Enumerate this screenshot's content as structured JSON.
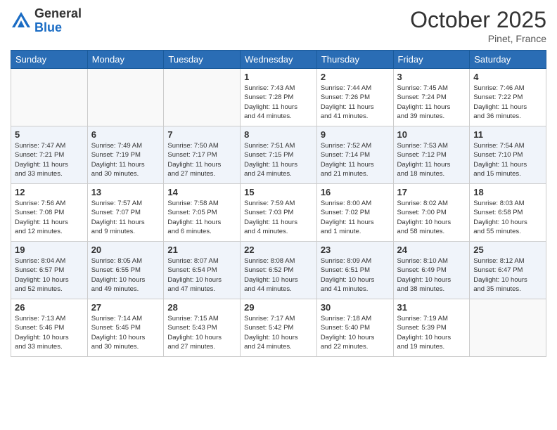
{
  "header": {
    "logo_general": "General",
    "logo_blue": "Blue",
    "month_title": "October 2025",
    "location": "Pinet, France"
  },
  "days_of_week": [
    "Sunday",
    "Monday",
    "Tuesday",
    "Wednesday",
    "Thursday",
    "Friday",
    "Saturday"
  ],
  "weeks": [
    {
      "alt": false,
      "days": [
        {
          "number": "",
          "info": ""
        },
        {
          "number": "",
          "info": ""
        },
        {
          "number": "",
          "info": ""
        },
        {
          "number": "1",
          "info": "Sunrise: 7:43 AM\nSunset: 7:28 PM\nDaylight: 11 hours\nand 44 minutes."
        },
        {
          "number": "2",
          "info": "Sunrise: 7:44 AM\nSunset: 7:26 PM\nDaylight: 11 hours\nand 41 minutes."
        },
        {
          "number": "3",
          "info": "Sunrise: 7:45 AM\nSunset: 7:24 PM\nDaylight: 11 hours\nand 39 minutes."
        },
        {
          "number": "4",
          "info": "Sunrise: 7:46 AM\nSunset: 7:22 PM\nDaylight: 11 hours\nand 36 minutes."
        }
      ]
    },
    {
      "alt": true,
      "days": [
        {
          "number": "5",
          "info": "Sunrise: 7:47 AM\nSunset: 7:21 PM\nDaylight: 11 hours\nand 33 minutes."
        },
        {
          "number": "6",
          "info": "Sunrise: 7:49 AM\nSunset: 7:19 PM\nDaylight: 11 hours\nand 30 minutes."
        },
        {
          "number": "7",
          "info": "Sunrise: 7:50 AM\nSunset: 7:17 PM\nDaylight: 11 hours\nand 27 minutes."
        },
        {
          "number": "8",
          "info": "Sunrise: 7:51 AM\nSunset: 7:15 PM\nDaylight: 11 hours\nand 24 minutes."
        },
        {
          "number": "9",
          "info": "Sunrise: 7:52 AM\nSunset: 7:14 PM\nDaylight: 11 hours\nand 21 minutes."
        },
        {
          "number": "10",
          "info": "Sunrise: 7:53 AM\nSunset: 7:12 PM\nDaylight: 11 hours\nand 18 minutes."
        },
        {
          "number": "11",
          "info": "Sunrise: 7:54 AM\nSunset: 7:10 PM\nDaylight: 11 hours\nand 15 minutes."
        }
      ]
    },
    {
      "alt": false,
      "days": [
        {
          "number": "12",
          "info": "Sunrise: 7:56 AM\nSunset: 7:08 PM\nDaylight: 11 hours\nand 12 minutes."
        },
        {
          "number": "13",
          "info": "Sunrise: 7:57 AM\nSunset: 7:07 PM\nDaylight: 11 hours\nand 9 minutes."
        },
        {
          "number": "14",
          "info": "Sunrise: 7:58 AM\nSunset: 7:05 PM\nDaylight: 11 hours\nand 6 minutes."
        },
        {
          "number": "15",
          "info": "Sunrise: 7:59 AM\nSunset: 7:03 PM\nDaylight: 11 hours\nand 4 minutes."
        },
        {
          "number": "16",
          "info": "Sunrise: 8:00 AM\nSunset: 7:02 PM\nDaylight: 11 hours\nand 1 minute."
        },
        {
          "number": "17",
          "info": "Sunrise: 8:02 AM\nSunset: 7:00 PM\nDaylight: 10 hours\nand 58 minutes."
        },
        {
          "number": "18",
          "info": "Sunrise: 8:03 AM\nSunset: 6:58 PM\nDaylight: 10 hours\nand 55 minutes."
        }
      ]
    },
    {
      "alt": true,
      "days": [
        {
          "number": "19",
          "info": "Sunrise: 8:04 AM\nSunset: 6:57 PM\nDaylight: 10 hours\nand 52 minutes."
        },
        {
          "number": "20",
          "info": "Sunrise: 8:05 AM\nSunset: 6:55 PM\nDaylight: 10 hours\nand 49 minutes."
        },
        {
          "number": "21",
          "info": "Sunrise: 8:07 AM\nSunset: 6:54 PM\nDaylight: 10 hours\nand 47 minutes."
        },
        {
          "number": "22",
          "info": "Sunrise: 8:08 AM\nSunset: 6:52 PM\nDaylight: 10 hours\nand 44 minutes."
        },
        {
          "number": "23",
          "info": "Sunrise: 8:09 AM\nSunset: 6:51 PM\nDaylight: 10 hours\nand 41 minutes."
        },
        {
          "number": "24",
          "info": "Sunrise: 8:10 AM\nSunset: 6:49 PM\nDaylight: 10 hours\nand 38 minutes."
        },
        {
          "number": "25",
          "info": "Sunrise: 8:12 AM\nSunset: 6:47 PM\nDaylight: 10 hours\nand 35 minutes."
        }
      ]
    },
    {
      "alt": false,
      "days": [
        {
          "number": "26",
          "info": "Sunrise: 7:13 AM\nSunset: 5:46 PM\nDaylight: 10 hours\nand 33 minutes."
        },
        {
          "number": "27",
          "info": "Sunrise: 7:14 AM\nSunset: 5:45 PM\nDaylight: 10 hours\nand 30 minutes."
        },
        {
          "number": "28",
          "info": "Sunrise: 7:15 AM\nSunset: 5:43 PM\nDaylight: 10 hours\nand 27 minutes."
        },
        {
          "number": "29",
          "info": "Sunrise: 7:17 AM\nSunset: 5:42 PM\nDaylight: 10 hours\nand 24 minutes."
        },
        {
          "number": "30",
          "info": "Sunrise: 7:18 AM\nSunset: 5:40 PM\nDaylight: 10 hours\nand 22 minutes."
        },
        {
          "number": "31",
          "info": "Sunrise: 7:19 AM\nSunset: 5:39 PM\nDaylight: 10 hours\nand 19 minutes."
        },
        {
          "number": "",
          "info": ""
        }
      ]
    }
  ]
}
